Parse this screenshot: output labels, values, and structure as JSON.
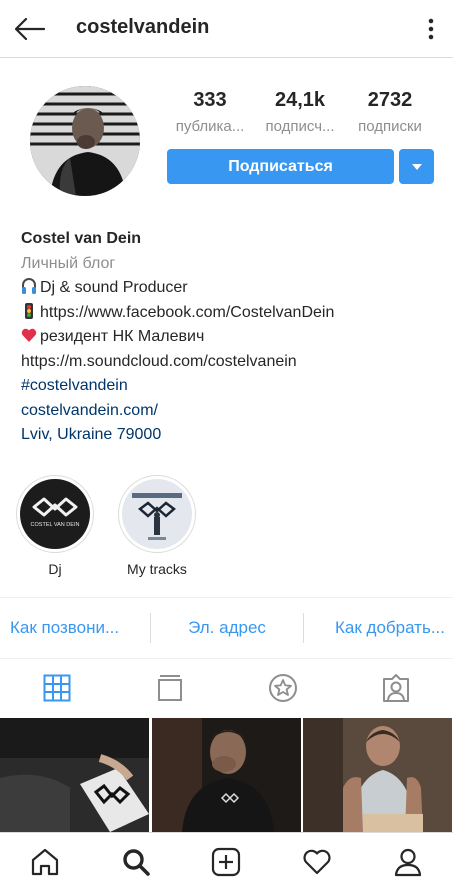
{
  "header": {
    "username": "costelvandein",
    "back_icon": "arrow-left-icon",
    "more_icon": "more-vertical-icon"
  },
  "profile": {
    "stats": [
      {
        "value": "333",
        "label": "публика..."
      },
      {
        "value": "24,1k",
        "label": "подписч..."
      },
      {
        "value": "2732",
        "label": "подписки"
      }
    ],
    "subscribe_label": "Подписаться",
    "accent_color": "#3897f0"
  },
  "bio": {
    "name": "Costel van Dein",
    "category": "Личный блог",
    "lines": [
      "Dj & sound Producer",
      "https://www.facebook.com/CostelvanDein",
      "резидент НК Малевич",
      "https://m.soundcloud.com/costelvanein"
    ],
    "hashtag": "#costelvandein",
    "website": "costelvandein.com/",
    "location": "Lviv, Ukraine 79000"
  },
  "highlights": [
    {
      "label": "Dj",
      "logo_text": "COSTEL VAN DEIN"
    },
    {
      "label": "My tracks"
    }
  ],
  "contact": {
    "call": "Как позвони...",
    "email": "Эл. адрес",
    "directions": "Как добрать..."
  },
  "tabs": [
    "grid-icon",
    "igtv-icon",
    "star-icon",
    "tagged-icon"
  ],
  "bottom_nav": [
    "home-icon",
    "search-icon",
    "add-post-icon",
    "heart-icon",
    "profile-icon"
  ]
}
